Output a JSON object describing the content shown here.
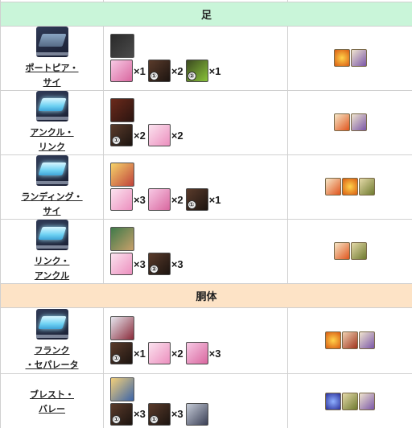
{
  "sections": [
    {
      "title": "足",
      "rows": [
        {
          "item_name_lines": [
            "ポートピア・",
            "サイ"
          ],
          "icon": "plate-dark-icon",
          "servant_icon": "servant-portrait-icon",
          "materials": [
            {
              "icon": "pink-scroll-icon",
              "badge": "",
              "qty": "×1"
            },
            {
              "icon": "dark-claw-icon",
              "badge": "①",
              "qty": "×2"
            },
            {
              "icon": "green-gear-icon",
              "badge": "②",
              "qty": "×1"
            }
          ],
          "rewards": [
            "fire-orb-icon",
            "purple-feather-icon"
          ]
        },
        {
          "item_name_lines": [
            "アンクル・",
            "リンク"
          ],
          "icon": "plate-blue-icon",
          "servant_icon": "servant-portrait-icon",
          "materials": [
            {
              "icon": "dark-claw-icon",
              "badge": "①",
              "qty": "×2"
            },
            {
              "icon": "pink-feather-icon",
              "badge": "",
              "qty": "×2"
            }
          ],
          "rewards": [
            "flame-icon",
            "purple-feather-icon"
          ]
        },
        {
          "item_name_lines": [
            "ランディング・",
            "サイ"
          ],
          "icon": "plate-blue-icon",
          "servant_icon": "servant-portrait-icon",
          "materials": [
            {
              "icon": "pink-feather-icon",
              "badge": "",
              "qty": "×3"
            },
            {
              "icon": "pink-scroll-icon",
              "badge": "",
              "qty": "×2"
            },
            {
              "icon": "dark-claw-icon",
              "badge": "①",
              "qty": "×1"
            }
          ],
          "rewards": [
            "flame-icon",
            "fire-orb-icon",
            "gold-helmet-icon"
          ]
        },
        {
          "item_name_lines": [
            "リンク・",
            "アンクル"
          ],
          "icon": "plate-blue-icon",
          "servant_icon": "servant-portrait-icon",
          "materials": [
            {
              "icon": "pink-feather-icon",
              "badge": "",
              "qty": "×3"
            },
            {
              "icon": "dark-claw-icon",
              "badge": "②",
              "qty": "×3"
            }
          ],
          "rewards": [
            "flame-icon",
            "gold-helmet-icon"
          ]
        }
      ]
    },
    {
      "title": "胴体",
      "rows": [
        {
          "item_name_lines": [
            "フランク",
            "・セパレータ"
          ],
          "icon": "plate-blue-icon",
          "servant_icon": "servant-portrait-icon",
          "materials": [
            {
              "icon": "dark-claw-icon",
              "badge": "①",
              "qty": "×1"
            },
            {
              "icon": "pink-feather-icon",
              "badge": "",
              "qty": "×2"
            },
            {
              "icon": "pink-scroll-icon",
              "badge": "",
              "qty": "×3"
            }
          ],
          "rewards": [
            "fire-orb-icon",
            "red-beast-icon",
            "purple-feather-icon"
          ]
        },
        {
          "item_name_lines": [
            "ブレスト・",
            "バレー"
          ],
          "icon": "none",
          "servant_icon": "servant-portrait-icon",
          "materials": [
            {
              "icon": "dark-claw-icon",
              "badge": "①",
              "qty": "×3"
            },
            {
              "icon": "dark-claw-icon",
              "badge": "①",
              "qty": "×3"
            },
            {
              "icon": "armor-icon",
              "badge": "",
              "qty": ""
            }
          ],
          "rewards": [
            "blue-orb-icon",
            "gold-helmet-icon",
            "purple-feather-icon"
          ]
        }
      ]
    }
  ],
  "colors": {
    "section_green": "#c9f5d9",
    "section_orange": "#fde3c6",
    "border": "#d0d0d0"
  }
}
